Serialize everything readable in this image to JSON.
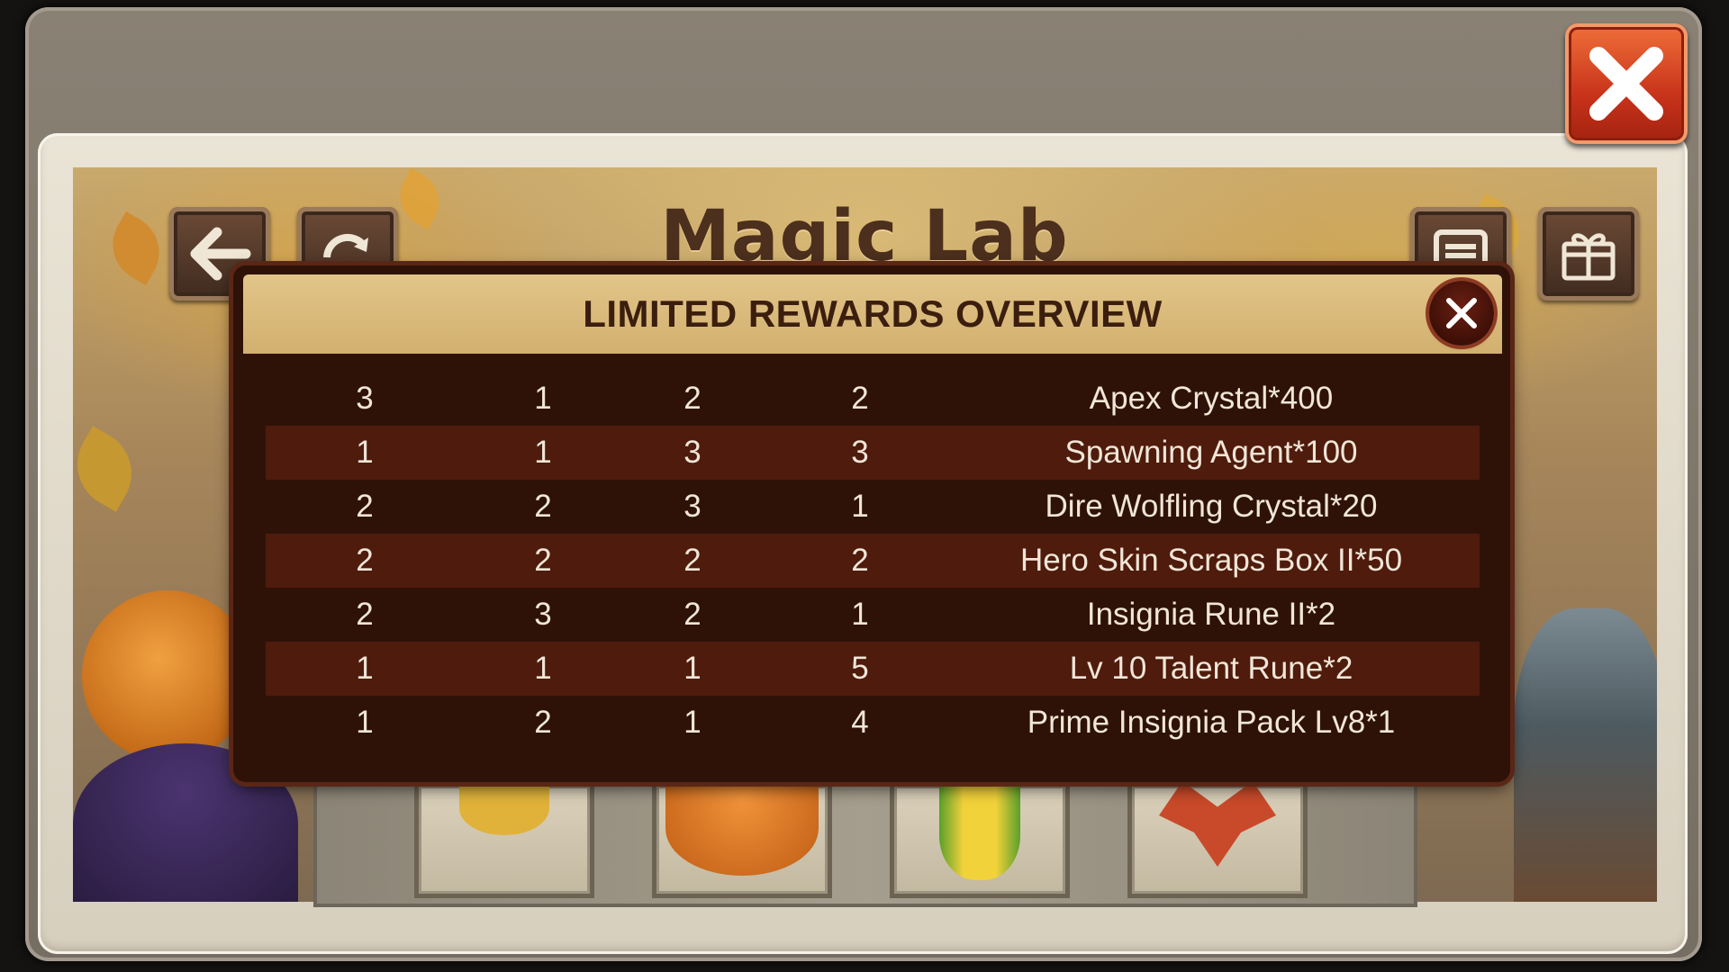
{
  "background": {
    "title": "Magic Lab",
    "buttons": {
      "back_icon": "arrow-left-icon",
      "refresh_icon": "refresh-icon",
      "list_icon": "list-icon",
      "gift_icon": "gift-icon",
      "close_icon": "close-icon"
    }
  },
  "modal": {
    "title": "LIMITED REWARDS OVERVIEW",
    "close_icon": "close-icon",
    "rows": [
      {
        "c1": "3",
        "c2": "1",
        "c3": "2",
        "c4": "2",
        "reward": "Apex Crystal*400"
      },
      {
        "c1": "1",
        "c2": "1",
        "c3": "3",
        "c4": "3",
        "reward": "Spawning Agent*100"
      },
      {
        "c1": "2",
        "c2": "2",
        "c3": "3",
        "c4": "1",
        "reward": "Dire Wolfling Crystal*20"
      },
      {
        "c1": "2",
        "c2": "2",
        "c3": "2",
        "c4": "2",
        "reward": "Hero Skin Scraps Box II*50"
      },
      {
        "c1": "2",
        "c2": "3",
        "c3": "2",
        "c4": "1",
        "reward": "Insignia Rune II*2"
      },
      {
        "c1": "1",
        "c2": "1",
        "c3": "1",
        "c4": "5",
        "reward": "Lv 10 Talent Rune*2"
      },
      {
        "c1": "1",
        "c2": "2",
        "c3": "1",
        "c4": "4",
        "reward": "Prime Insignia Pack Lv8*1"
      }
    ]
  },
  "colors": {
    "modal_bg": "#2e1208",
    "row_alt": "#4f1b0c",
    "header_gold": "#d9b97a",
    "close_red": "#c8321a"
  }
}
